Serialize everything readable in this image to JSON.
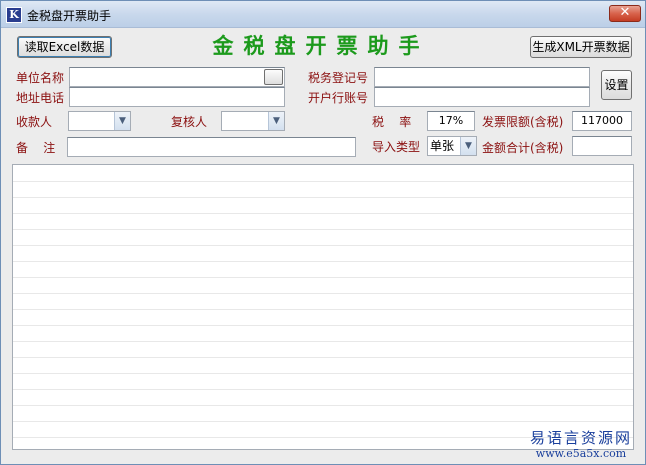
{
  "window": {
    "title": "金税盘开票助手",
    "icon_letter": "K",
    "close_symbol": "✕"
  },
  "toolbar": {
    "read_excel_label": "读取Excel数据",
    "app_heading": "金税盘开票助手",
    "generate_xml_label": "生成XML开票数据",
    "settings_label": "设置"
  },
  "form": {
    "company_name_label": "单位名称",
    "company_name_value": "",
    "lookup_button_label": "···",
    "address_phone_label": "地址电话",
    "address_phone_value": "",
    "tax_reg_label": "税务登记号",
    "tax_reg_value": "",
    "bank_account_label": "开户行账号",
    "bank_account_value": "",
    "payee_label": "收款人",
    "payee_value": "",
    "reviewer_label": "复核人",
    "reviewer_value": "",
    "tax_rate_label": "税    率",
    "tax_rate_value": "17%",
    "invoice_limit_label": "发票限额(含税)",
    "invoice_limit_value": "117000",
    "remarks_label": "备    注",
    "remarks_value": "",
    "import_type_label": "导入类型",
    "import_type_value": "单张",
    "total_amount_label": "金额合计(含税)",
    "total_amount_value": ""
  },
  "watermark": {
    "chinese": "易语言资源网",
    "url": "www.e5a5x.com"
  },
  "icons": {
    "dropdown": "chevron-down-icon"
  }
}
